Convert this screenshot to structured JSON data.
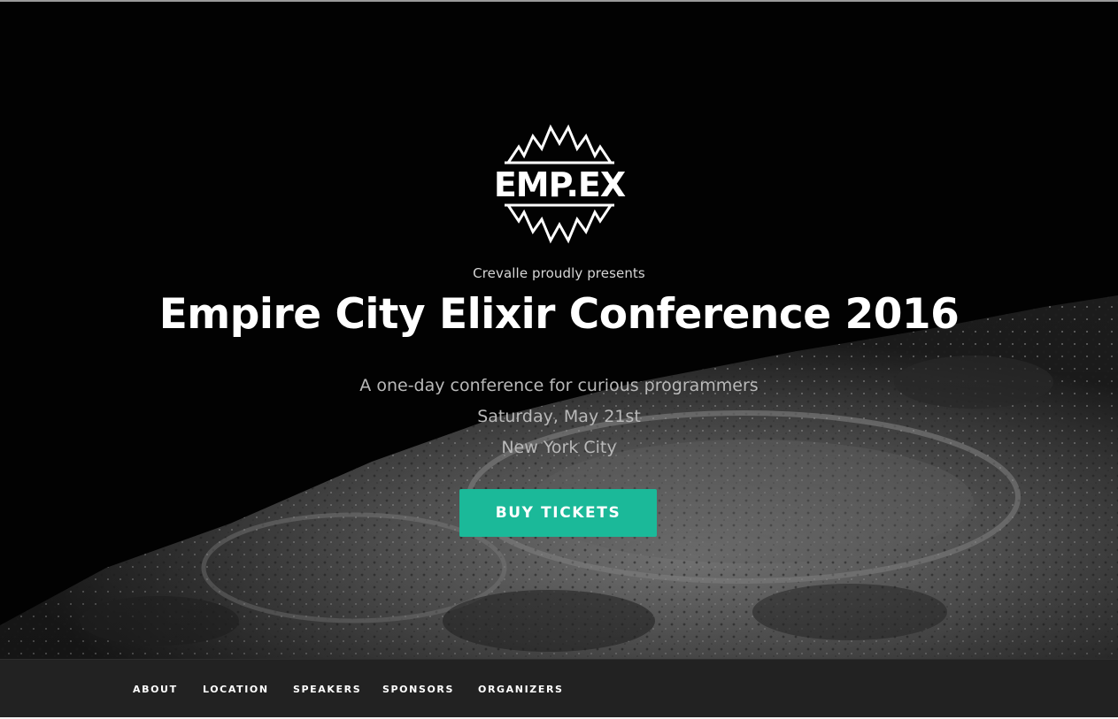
{
  "logo": {
    "text": "EMP.EX"
  },
  "hero": {
    "presenter": "Crevalle proudly presents",
    "title": "Empire City Elixir Conference 2016",
    "tagline": "A one-day conference for curious programmers",
    "date": "Saturday, May 21st",
    "location": "New York City",
    "cta_label": "BUY TICKETS"
  },
  "nav": {
    "items": [
      {
        "label": "ABOUT"
      },
      {
        "label": "LOCATION"
      },
      {
        "label": "SPEAKERS"
      },
      {
        "label": "SPONSORS"
      },
      {
        "label": "ORGANIZERS"
      }
    ]
  },
  "colors": {
    "accent": "#1bb999",
    "navbar": "#222222",
    "background": "#000000"
  }
}
